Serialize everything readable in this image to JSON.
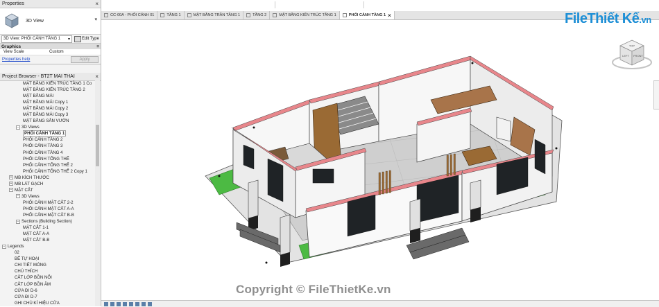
{
  "properties": {
    "title": "Properties",
    "type_name": "3D View",
    "view_selector": "3D View: PHỐI CẢNH TẦNG 1",
    "edit_type_label": "Edit Type",
    "group_graphics": "Graphics",
    "view_scale_label": "View Scale",
    "view_scale_value": "Custom",
    "help_link": "Properties help",
    "apply_label": "Apply"
  },
  "browser": {
    "title": "Project Browser - BT2T MAI THAI",
    "items": [
      {
        "label": "MẶT BẰNG KIẾN TRÚC TẦNG 1 Co",
        "level": 3
      },
      {
        "label": "MẶT BẰNG KIẾN TRÚC TẦNG 2",
        "level": 3
      },
      {
        "label": "MẶT BẰNG MÁI",
        "level": 3
      },
      {
        "label": "MẶT BẰNG MÁI Copy 1",
        "level": 3
      },
      {
        "label": "MẶT BẰNG MÁI Copy 2",
        "level": 3
      },
      {
        "label": "MẶT BẰNG MÁI Copy 3",
        "level": 3
      },
      {
        "label": "MẶT BẰNG SÂN VƯỜN",
        "level": 3
      },
      {
        "label": "3D Views",
        "level": 2,
        "toggle": "−"
      },
      {
        "label": "PHỐI CẢNH TẦNG 1",
        "level": 3,
        "selected": true
      },
      {
        "label": "PHỐI CẢNH TẦNG 2",
        "level": 3
      },
      {
        "label": "PHỐI CẢNH TẦNG 3",
        "level": 3
      },
      {
        "label": "PHỐI CẢNH TẦNG 4",
        "level": 3
      },
      {
        "label": "PHỐI CẢNH TỔNG THỂ",
        "level": 3
      },
      {
        "label": "PHỐI CẢNH TỔNG THỂ 2",
        "level": 3
      },
      {
        "label": "PHỐI CẢNH TỔNG THỂ 2 Copy 1",
        "level": 3
      },
      {
        "label": "MB KÍCH THƯỚC",
        "level": 1,
        "toggle": "+"
      },
      {
        "label": "MB LÁT GẠCH",
        "level": 1,
        "toggle": "+"
      },
      {
        "label": "MẶT CẮT",
        "level": 1,
        "toggle": "−"
      },
      {
        "label": "3D Views",
        "level": 2,
        "toggle": "−"
      },
      {
        "label": "PHỐI CẢNH MẶT CẮT 2-2",
        "level": 3
      },
      {
        "label": "PHỐI CẢNH MẶT CẮT A-A",
        "level": 3
      },
      {
        "label": "PHỐI CẢNH MẶT CẮT B-B",
        "level": 3
      },
      {
        "label": "Sections (Building Section)",
        "level": 2,
        "toggle": "−"
      },
      {
        "label": "MẶT CẮT 1-1",
        "level": 3
      },
      {
        "label": "MẶT CẮT A-A",
        "level": 3
      },
      {
        "label": "MẶT CẮT B-B",
        "level": 3
      },
      {
        "label": "Legends",
        "level": 0,
        "toggle": "−"
      },
      {
        "label": "02",
        "level": 1
      },
      {
        "label": "BỂ TỰ HOẠI",
        "level": 1
      },
      {
        "label": "CHI TIẾT MÓNG",
        "level": 1
      },
      {
        "label": "CHÚ THÍCH",
        "level": 1
      },
      {
        "label": "CẮT LỚP BỒN NỔI",
        "level": 1
      },
      {
        "label": "CẮT LỚP BỒN ÂM",
        "level": 1
      },
      {
        "label": "CỬA ĐI D-6",
        "level": 1
      },
      {
        "label": "CỬA ĐI D-7",
        "level": 1
      },
      {
        "label": "GHI CHÚ KÍ HIỆU CỬA",
        "level": 1
      }
    ]
  },
  "tabs": [
    {
      "label": "CC-00A - PHỐI CẢNH 01",
      "closable": false
    },
    {
      "label": "TẦNG 1",
      "closable": false
    },
    {
      "label": "MẶT BẰNG TRẦN TẦNG 1",
      "closable": false
    },
    {
      "label": "TẦNG 2",
      "closable": false
    },
    {
      "label": "MẶT BẰNG KIẾN TRÚC TẦNG 1",
      "closable": false
    },
    {
      "label": "PHỐI CẢNH TẦNG 1",
      "closable": true,
      "active": true
    }
  ],
  "viewcube": {
    "top": "TOP",
    "left": "LEFT",
    "front": "FRONT"
  },
  "watermark": {
    "logo_main": "File",
    "logo_rest": "Thiết Kế",
    "logo_suffix": ".vn",
    "copyright": "Copyright © FileThietKe.vn"
  },
  "colors": {
    "wall_top": "#e8868b",
    "wall": "#ffffff",
    "floor": "#cfcfcf",
    "wood": "#9a6a34",
    "glass": "#1f2326",
    "grass": "#4cba43",
    "steps": "#6a6a6a"
  }
}
